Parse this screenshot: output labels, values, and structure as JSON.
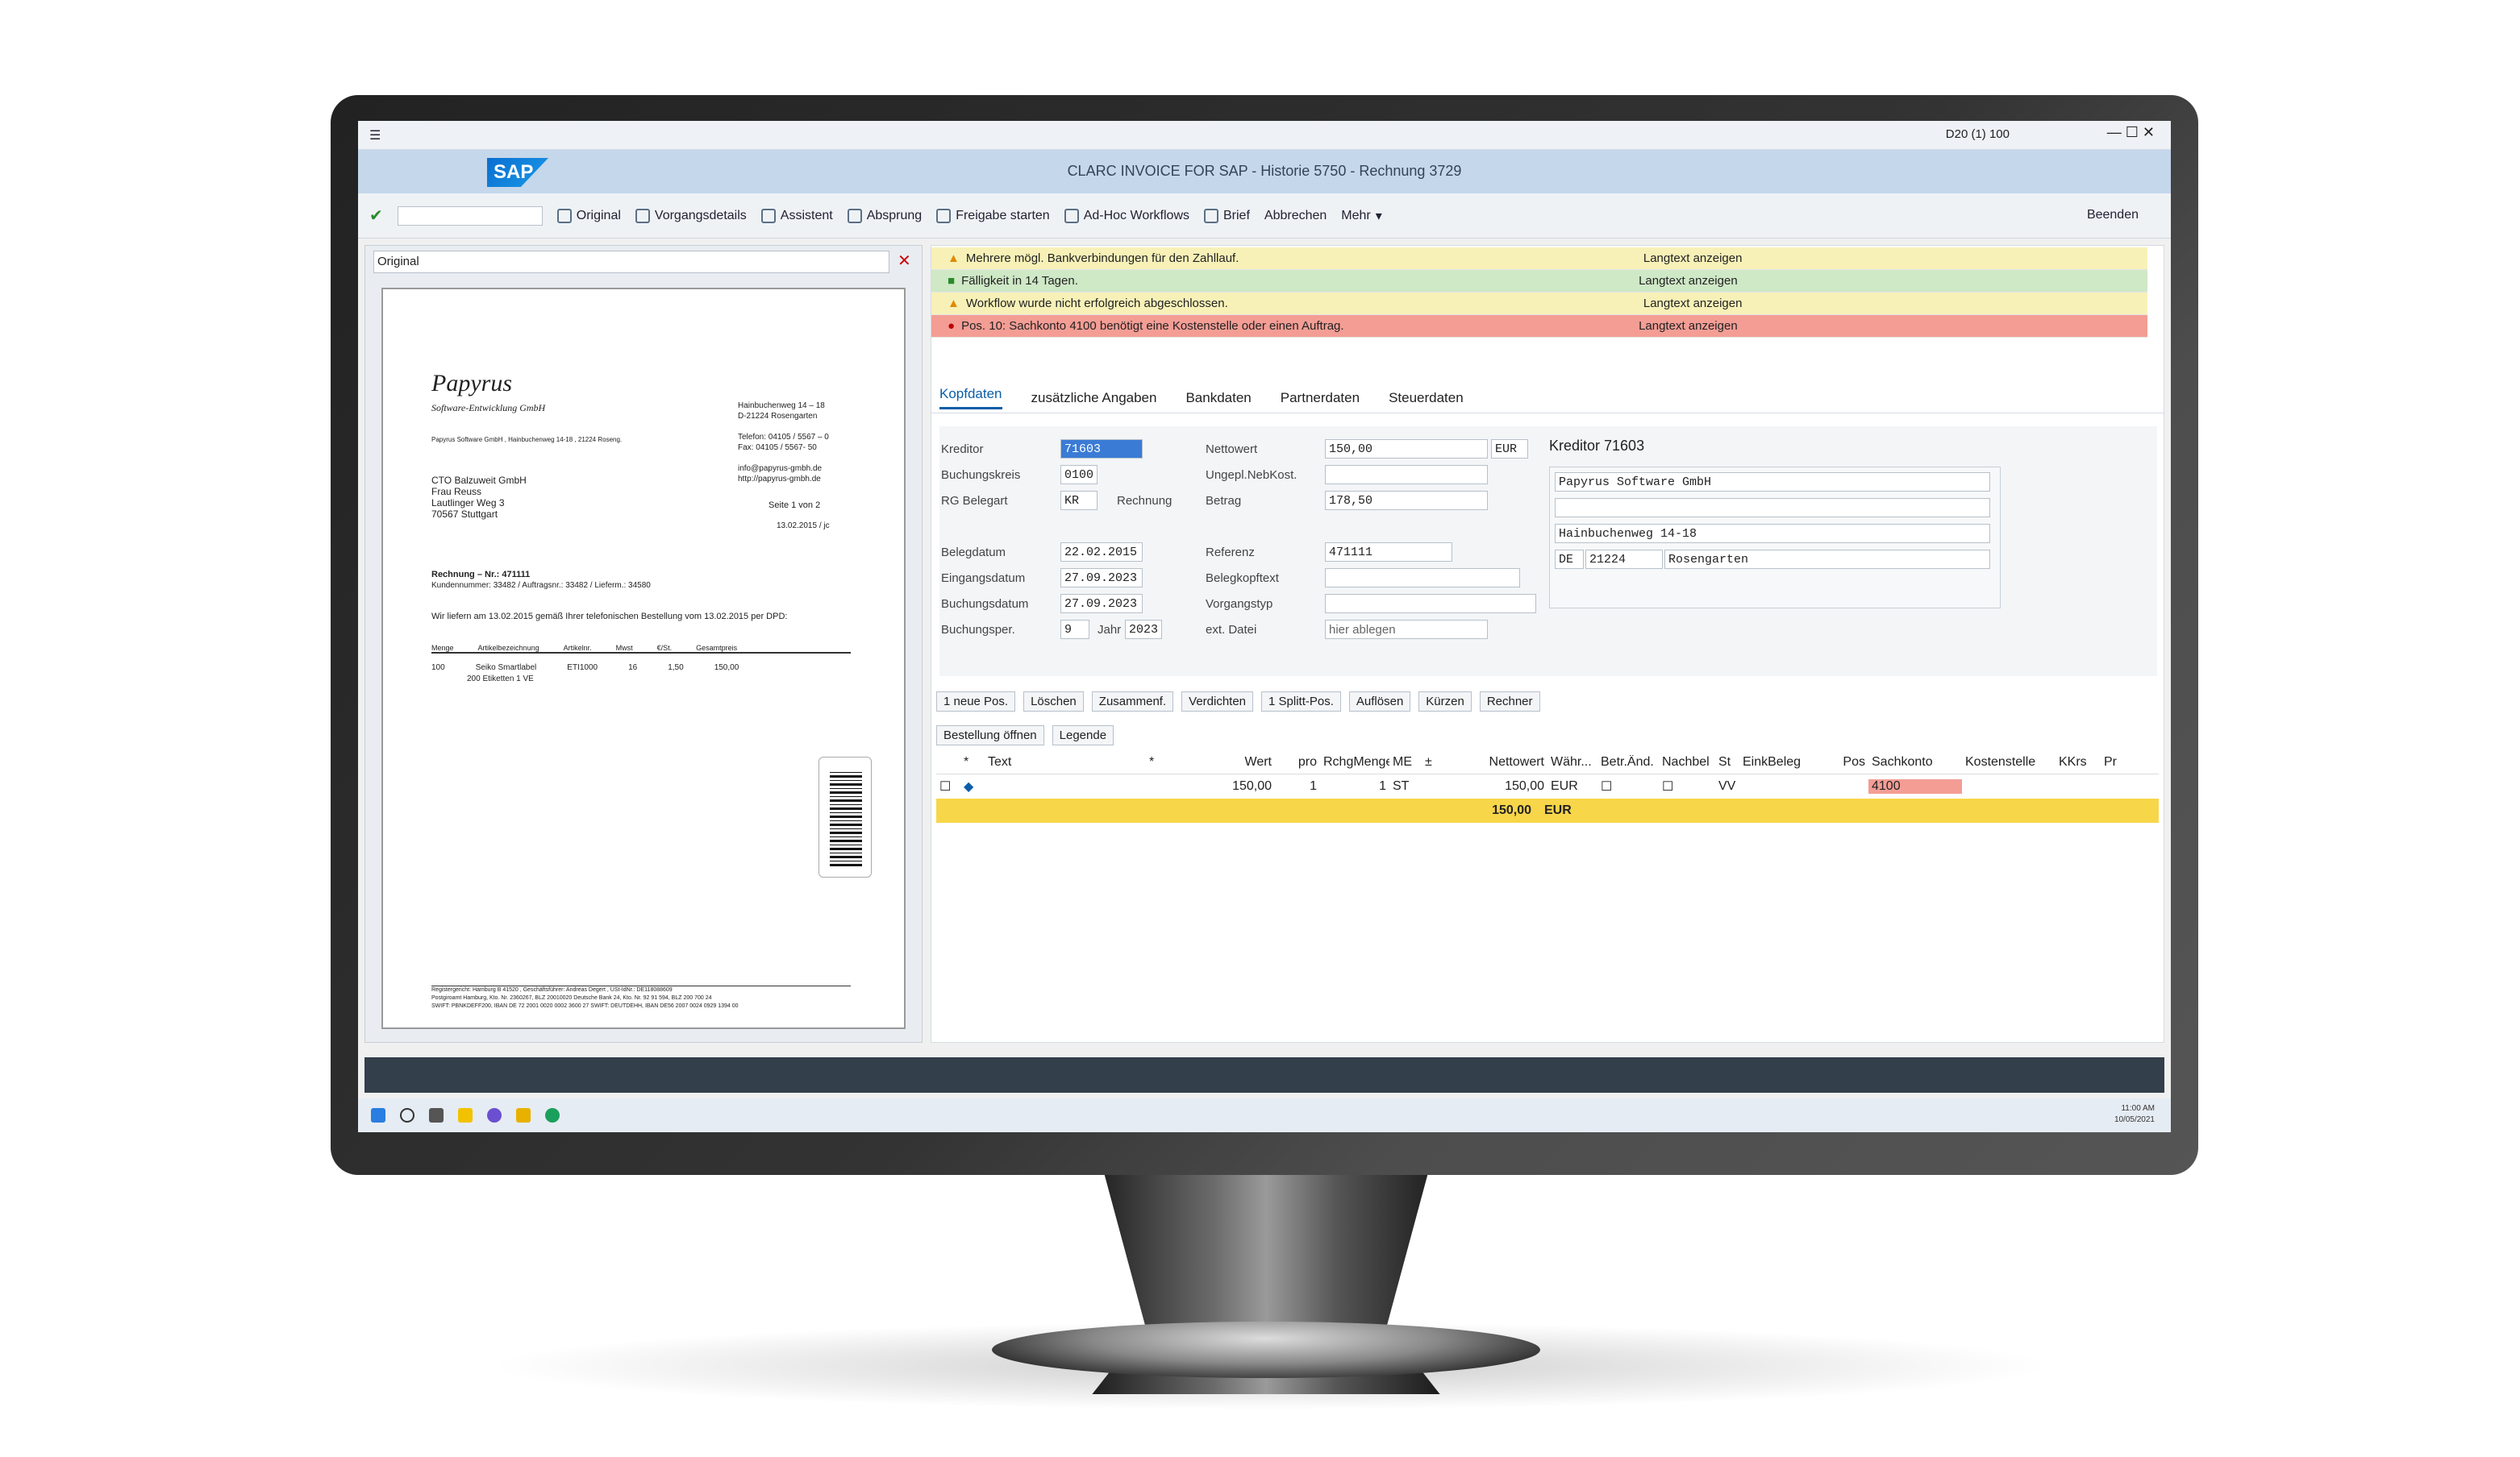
{
  "app": {
    "title": "CLARC INVOICE FOR SAP - Historie 5750 - Rechnung 3729",
    "sys": "D20 (1) 100"
  },
  "toolbar": {
    "items": [
      "Original",
      "Vorgangsdetails",
      "Assistent",
      "Absprung",
      "Freigabe starten",
      "Ad-Hoc Workflows",
      "Brief",
      "Abbrechen",
      "Mehr",
      "Beenden"
    ]
  },
  "left": {
    "dropdown": "Original"
  },
  "invoice": {
    "company": "Papyrus",
    "company_sub": "Software-Entwicklung GmbH",
    "sender_line": "Papyrus Software GmbH , Hainbuchenweg 14-18 , 21224 Roseng.",
    "addr1": "Hainbuchenweg 14 – 18",
    "addr2": "D-21224 Rosengarten",
    "tel": "Telefon: 04105 / 5567 – 0",
    "fax": "Fax:     04105 / 5567- 50",
    "email": "info@papyrus-gmbh.de",
    "web": "http://papyrus-gmbh.de",
    "to1": "CTO Balzuweit GmbH",
    "to2": "Frau Reuss",
    "to3": "Lautlinger Weg 3",
    "to4": "70567 Stuttgart",
    "page": "Seite 1 von 2",
    "date": "13.02.2015  / jc",
    "rechnung": "Rechnung – Nr.: 471111",
    "kundennr": "Kundennummer: 33482 / Auftragsnr.: 33482 / Lieferm.: 34580",
    "intro": "Wir liefern am  13.02.2015   gemäß Ihrer telefonischen Bestellung vom  13.02.2015  per DPD:",
    "cols": [
      "Menge",
      "Artikelbezeichnung",
      "Artikelnr.",
      "Mwst",
      "€/St.",
      "Gesamtpreis"
    ],
    "line": [
      "100",
      "Seiko Smartlabel",
      "ETI1000",
      "16",
      "1,50",
      "150,00"
    ],
    "line2": "200 Etiketten 1 VE",
    "footer1": "Registergericht: Hamburg B 41520 , Geschäftsführer: Andreas Degert , USt-IdNr.: DE118088609",
    "footer2": "Postgiroamt Hamburg, Kto. Nr. 2360267, BLZ 20010020          Deutsche Bank 24, Kto. Nr. 92 91 594, BLZ 200 700 24",
    "footer3": "SWIFT: PBNKDEFF200, IBAN DE 72 2001 0020 0002 3600 27         SWIFT: DEUTDEHH, IBAN DE56 2007 0024 0929 1394 00"
  },
  "messages": [
    {
      "text": "Mehrere mögl. Bankverbindungen für den Zahllauf.",
      "link": "Langtext anzeigen",
      "type": "warn"
    },
    {
      "text": "Fälligkeit in 14 Tagen.",
      "link": "Langtext anzeigen",
      "type": "ok"
    },
    {
      "text": "Workflow wurde nicht erfolgreich abgeschlossen.",
      "link": "Langtext anzeigen",
      "type": "warn"
    },
    {
      "text": "Pos. 10: Sachkonto 4100 benötigt eine Kostenstelle oder einen Auftrag.",
      "link": "Langtext anzeigen",
      "type": "err"
    }
  ],
  "tabs": [
    "Kopfdaten",
    "zusätzliche Angaben",
    "Bankdaten",
    "Partnerdaten",
    "Steuerdaten"
  ],
  "form": {
    "Kreditor": "71603",
    "Buchungskreis": "0100",
    "RG Belegart": "KR",
    "Rechnung": "Rechnung",
    "Nettowert": "150,00",
    "Nettowert_cur": "EUR",
    "Ungepl.NebKost.": "",
    "Betrag": "178,50",
    "Belegdatum": "22.02.2015",
    "Eingangsdatum": "27.09.2023",
    "Buchungsdatum": "27.09.2023",
    "Buchungsper_month": "9",
    "Jahr": "Jahr",
    "Buchungsper_year": "2023",
    "Referenz": "471111",
    "ext_datei": "hier ablegen",
    "labels": [
      "Kreditor",
      "Buchungskreis",
      "RG Belegart",
      "Belegdatum",
      "Eingangsdatum",
      "Buchungsdatum",
      "Buchungsper.",
      "Nettowert",
      "Ungepl.NebKost.",
      "Betrag",
      "Referenz",
      "Belegkopftext",
      "Vorgangstyp",
      "ext. Datei"
    ]
  },
  "kreditor": {
    "title": "Kreditor 71603",
    "name": "Papyrus Software GmbH",
    "street": "Hainbuchenweg 14-18",
    "country": "DE",
    "zip": "21224",
    "city": "Rosengarten"
  },
  "grid_toolbar": [
    "1 neue Pos.",
    "Löschen",
    "Zusammenf.",
    "Verdichten",
    "1 Splitt-Pos.",
    "Auflösen",
    "Kürzen",
    "Rechner",
    "Bestellung öffnen",
    "Legende"
  ],
  "grid": {
    "headers": [
      "*",
      "Text",
      "*",
      "Wert",
      "pro",
      "RchgMenge",
      "ME",
      "±",
      "Nettowert",
      "Währ...",
      "Betr.Änd.",
      "Nachbel",
      "St",
      "EinkBeleg",
      "Pos",
      "Sachkonto",
      "Kostenstelle",
      "KKrs",
      "Pr"
    ],
    "row": [
      "150,00",
      "1",
      "1",
      "ST",
      "150,00",
      "EUR",
      "VV",
      "4100"
    ],
    "total_value": "150,00",
    "total_cur": "EUR"
  },
  "taskbar": {
    "time": "11:00 AM",
    "date": "10/05/2021"
  }
}
